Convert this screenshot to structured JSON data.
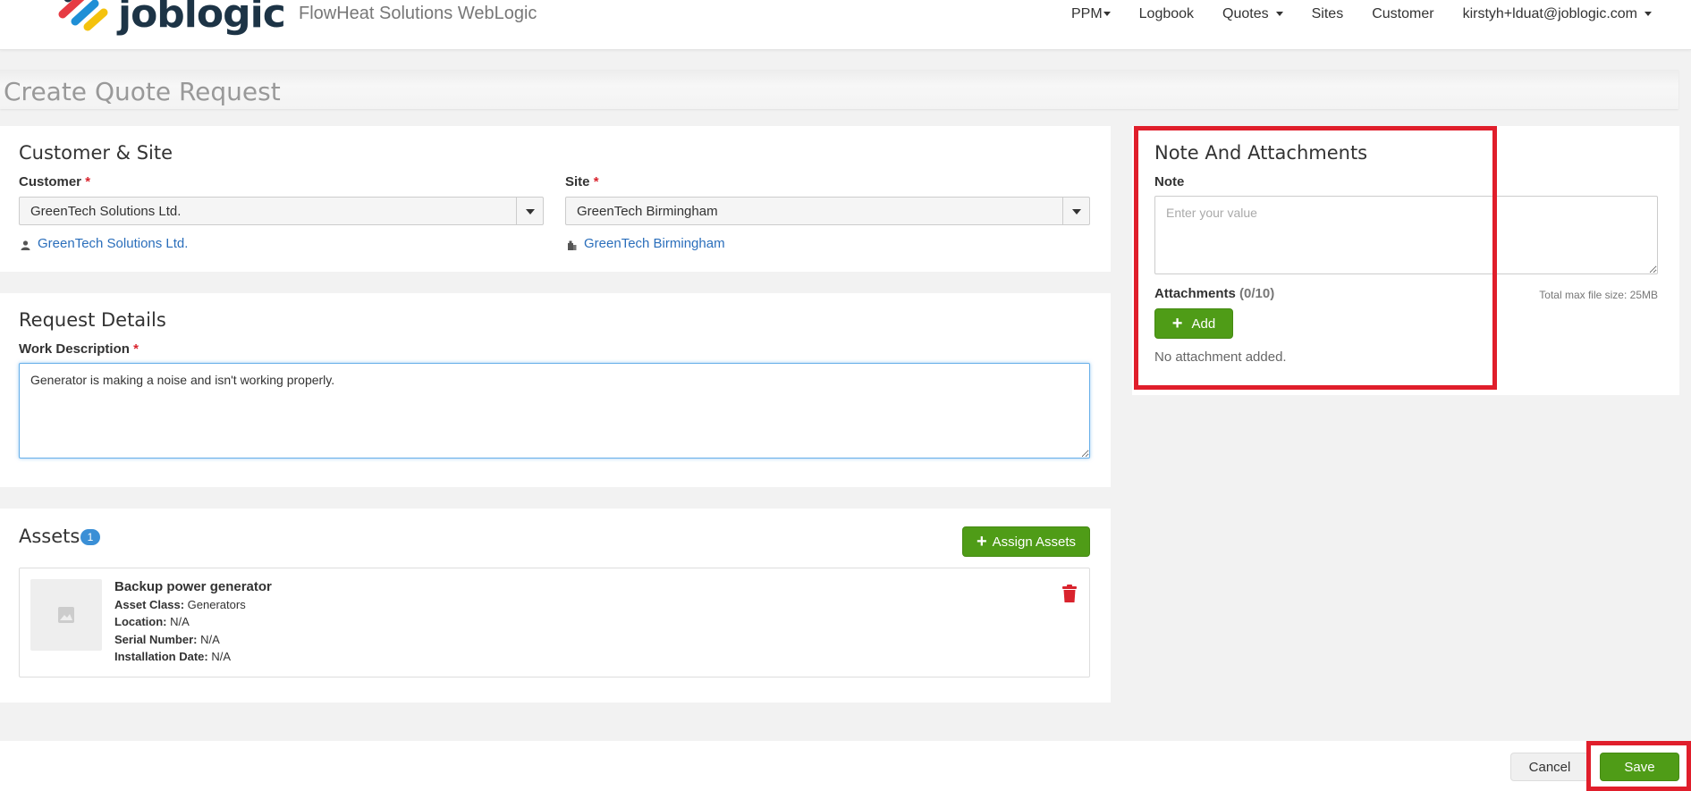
{
  "header": {
    "logo_text": "joblogic",
    "company_name": "FlowHeat Solutions WebLogic",
    "nav": [
      {
        "label": "PPM",
        "dropdown": true
      },
      {
        "label": "Logbook",
        "dropdown": false
      },
      {
        "label": "Quotes",
        "dropdown": true
      },
      {
        "label": "Sites",
        "dropdown": false
      },
      {
        "label": "Customer",
        "dropdown": false
      },
      {
        "label": "kirstyh+lduat@joblogic.com",
        "dropdown": true
      }
    ]
  },
  "page": {
    "title": "Create Quote Request"
  },
  "customer_site": {
    "title": "Customer & Site",
    "customer_label": "Customer",
    "customer_value": "GreenTech Solutions Ltd.",
    "customer_link": "GreenTech Solutions Ltd.",
    "site_label": "Site",
    "site_value": "GreenTech Birmingham",
    "site_link": "GreenTech Birmingham",
    "required_mark": "*"
  },
  "request_details": {
    "title": "Request Details",
    "work_description_label": "Work Description",
    "work_description_value": "Generator is making a noise and isn't working properly."
  },
  "assets": {
    "title": "Assets",
    "count": "1",
    "assign_label": "Assign Assets",
    "items": [
      {
        "name": "Backup power generator",
        "class_label": "Asset Class:",
        "class_value": "Generators",
        "location_label": "Location:",
        "location_value": "N/A",
        "serial_label": "Serial Number:",
        "serial_value": "N/A",
        "install_label": "Installation Date:",
        "install_value": "N/A"
      }
    ]
  },
  "notes": {
    "title": "Note And Attachments",
    "note_label": "Note",
    "note_placeholder": "Enter your value",
    "attachments_label": "Attachments",
    "attachments_count": "(0/10)",
    "max_size": "Total max file size: 25MB",
    "add_label": "Add",
    "empty_text": "No attachment added."
  },
  "footer": {
    "cancel_label": "Cancel",
    "save_label": "Save"
  },
  "colors": {
    "accent_green": "#4f9c17",
    "link_blue": "#2a6ebb",
    "highlight_red": "#e01e2b",
    "badge_blue": "#3a8fd6"
  }
}
